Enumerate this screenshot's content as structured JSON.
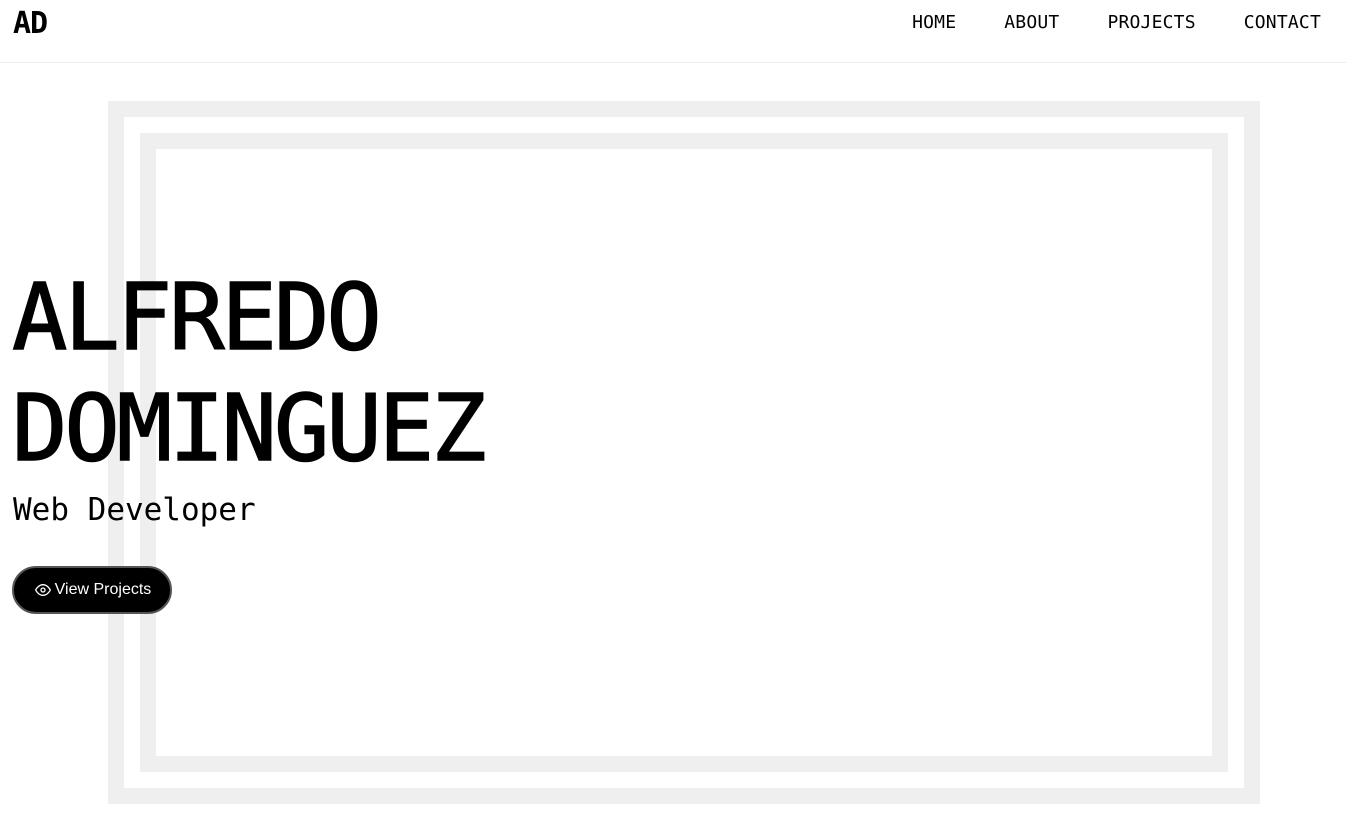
{
  "header": {
    "logo": "AD",
    "nav": [
      "HOME",
      "ABOUT",
      "PROJECTS",
      "CONTACT"
    ]
  },
  "hero": {
    "name_line1": "ALFREDO",
    "name_line2": "DOMINGUEZ",
    "subtitle": "Web Developer",
    "cta_label": "View Projects",
    "cta_icon": "eye-icon"
  },
  "colors": {
    "background": "#ffffff",
    "text": "#000000",
    "frame": "#efefef",
    "button_bg": "#000000",
    "button_text": "#ffffff"
  }
}
